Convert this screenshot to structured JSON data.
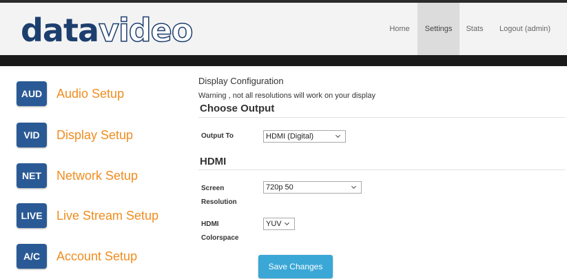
{
  "brand": {
    "logo_bold": "data",
    "logo_outline": "video",
    "logo_color": "#1d3f6e"
  },
  "nav": {
    "items": [
      {
        "label": "Home",
        "active": false
      },
      {
        "label": "Settings",
        "active": true
      },
      {
        "label": "Stats",
        "active": false
      },
      {
        "label": "Logout (admin)",
        "active": false
      }
    ]
  },
  "sidebar": {
    "accent_color": "#f08c1e",
    "badge_color": "#2a5a96",
    "items": [
      {
        "badge": "AUD",
        "label": "Audio Setup"
      },
      {
        "badge": "VID",
        "label": "Display Setup"
      },
      {
        "badge": "NET",
        "label": "Network Setup"
      },
      {
        "badge": "LIVE",
        "label": "Live Stream Setup"
      },
      {
        "badge": "A/C",
        "label": "Account Setup"
      }
    ]
  },
  "main": {
    "title": "Display Configuration",
    "warning": "Warning , not all resolutions will work on your display",
    "choose_output": {
      "heading": "Choose Output",
      "output_to_label": "Output To",
      "output_to_value": "HDMI (Digital)"
    },
    "hdmi": {
      "heading": "HDMI",
      "screen_resolution_label_1": "Screen",
      "screen_resolution_label_2": "Resolution",
      "screen_resolution_value": "720p 50",
      "colorspace_label_1": "HDMI",
      "colorspace_label_2": "Colorspace",
      "colorspace_value": "YUV"
    },
    "save_label": "Save Changes",
    "save_color": "#3aa7d6"
  }
}
